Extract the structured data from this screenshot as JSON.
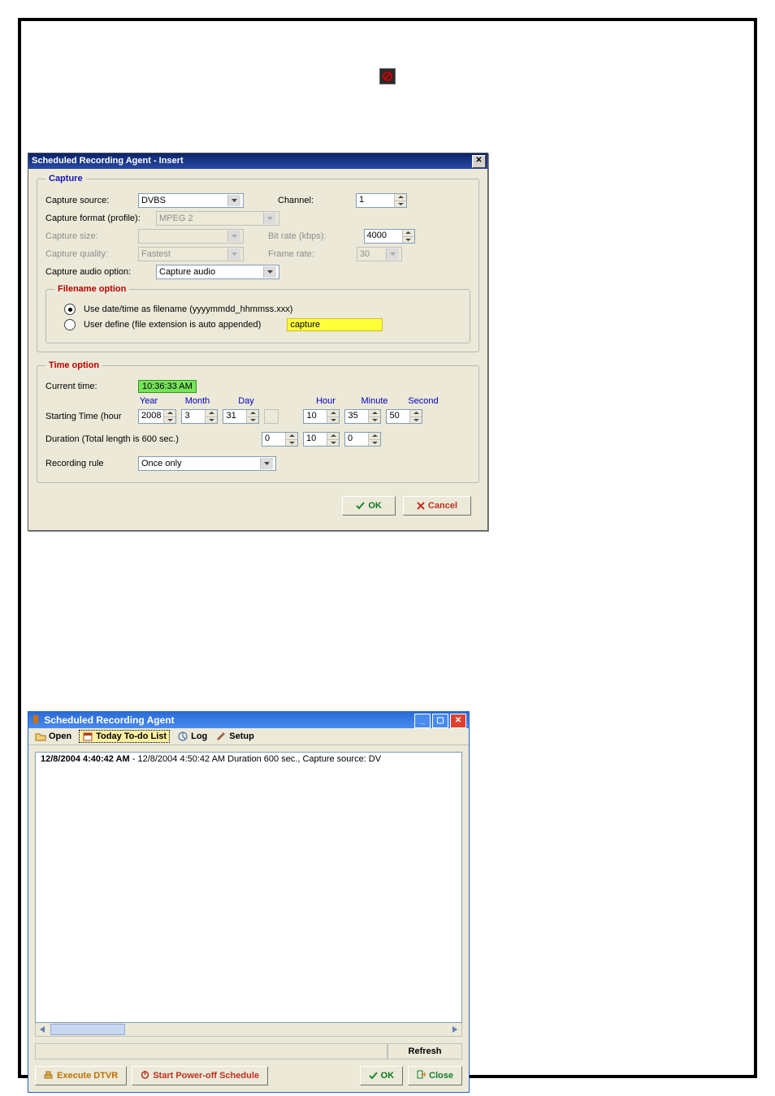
{
  "dlg1": {
    "title": "Scheduled Recording Agent - Insert",
    "capture": {
      "legend": "Capture",
      "source_lbl": "Capture source:",
      "source_val": "DVBS",
      "channel_lbl": "Channel:",
      "channel_val": "1",
      "format_lbl": "Capture format (profile):",
      "format_val": "MPEG 2",
      "size_lbl": "Capture size:",
      "size_val": "",
      "bitrate_lbl": "Bit rate (kbps):",
      "bitrate_val": "4000",
      "quality_lbl": "Capture quality:",
      "quality_val": "Fastest",
      "framerate_lbl": "Frame rate:",
      "framerate_val": "30",
      "audio_lbl": "Capture audio option:",
      "audio_val": "Capture audio"
    },
    "filename": {
      "legend": "Filename option",
      "opt1": "Use date/time as filename (yyyymmdd_hhmmss.xxx)",
      "opt2": "User define (file extension is auto appended)",
      "userfile": "capture"
    },
    "time": {
      "legend": "Time option",
      "current_lbl": "Current time:",
      "current_val": "10:36:33 AM",
      "hdr": [
        "Year",
        "Month",
        "Day",
        "Hour",
        "Minute",
        "Second"
      ],
      "start_lbl": "Starting Time (hour",
      "year": "2008",
      "month": "3",
      "day": "31",
      "day_extra": "",
      "hour": "10",
      "minute": "35",
      "second": "50",
      "dur_lbl": "Duration (Total length is 600 sec.)",
      "dur_h": "0",
      "dur_m": "10",
      "dur_s": "0",
      "rule_lbl": "Recording rule",
      "rule_val": "Once only"
    },
    "ok": "OK",
    "cancel": "Cancel"
  },
  "dlg2": {
    "title": "Scheduled Recording Agent",
    "tb": {
      "open": "Open",
      "today": "Today To-do List",
      "log": "Log",
      "setup": "Setup"
    },
    "row_a": "12/8/2004 4:40:42 AM",
    "row_sep": " - ",
    "row_b": "12/8/2004 4:50:42 AM Duration 600 sec., Capture source: DV",
    "refresh": "Refresh",
    "exec": "Execute DTVR",
    "start": "Start Power-off Schedule",
    "ok": "OK",
    "close": "Close"
  }
}
